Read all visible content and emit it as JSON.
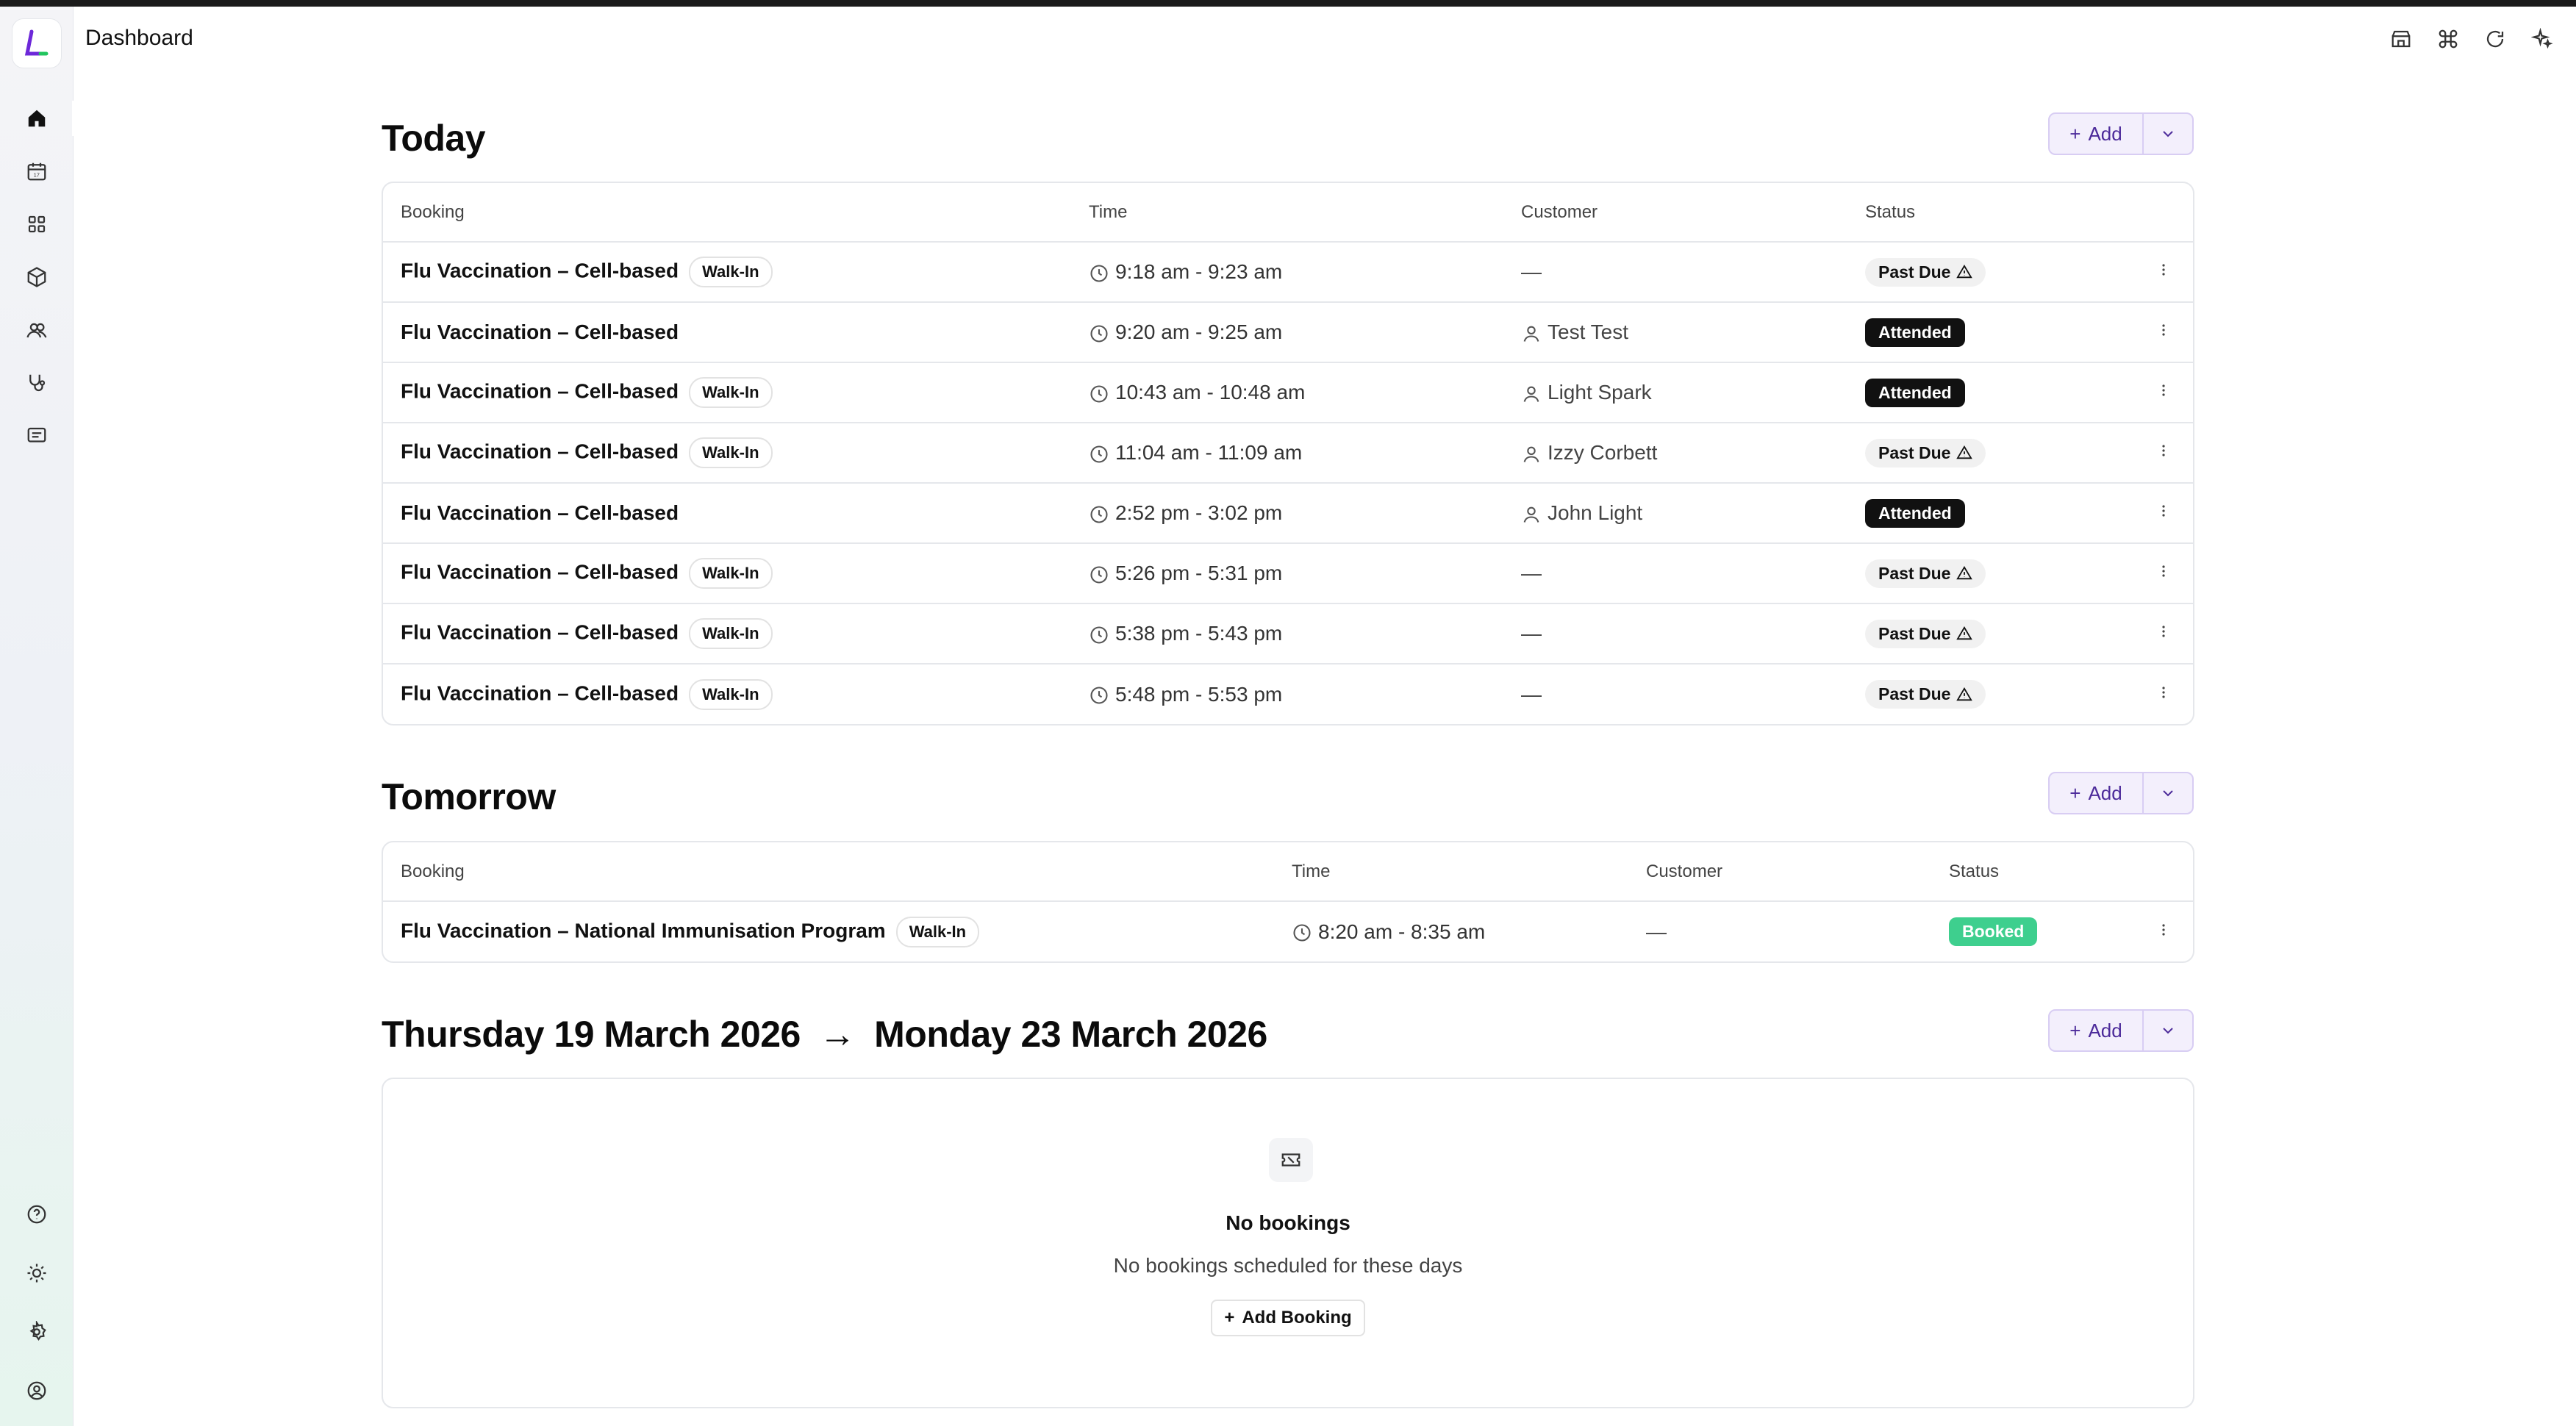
{
  "header": {
    "title": "Dashboard"
  },
  "sidebar": {
    "items": [
      {
        "name": "home-icon"
      },
      {
        "name": "calendar-icon"
      },
      {
        "name": "apps-grid-icon"
      },
      {
        "name": "package-icon"
      },
      {
        "name": "users-icon"
      },
      {
        "name": "stethoscope-icon"
      },
      {
        "name": "message-icon"
      }
    ],
    "bottom": [
      {
        "name": "help-icon"
      },
      {
        "name": "sun-icon"
      },
      {
        "name": "gear-icon"
      },
      {
        "name": "account-icon"
      }
    ]
  },
  "top_icons": [
    "store-icon",
    "command-icon",
    "refresh-icon",
    "sparkle-icon"
  ],
  "buttons": {
    "add": "Add",
    "add_booking": "Add Booking"
  },
  "columns": {
    "booking": "Booking",
    "time": "Time",
    "customer": "Customer",
    "status": "Status"
  },
  "today": {
    "title": "Today",
    "rows": [
      {
        "booking": "Flu Vaccination – Cell-based",
        "tag": "Walk-In",
        "time": "9:18 am - 9:23 am",
        "customer": "—",
        "status": "Past Due"
      },
      {
        "booking": "Flu Vaccination – Cell-based",
        "tag": "",
        "time": "9:20 am - 9:25 am",
        "customer": "Test Test",
        "status": "Attended"
      },
      {
        "booking": "Flu Vaccination – Cell-based",
        "tag": "Walk-In",
        "time": "10:43 am - 10:48 am",
        "customer": "Light Spark",
        "status": "Attended"
      },
      {
        "booking": "Flu Vaccination – Cell-based",
        "tag": "Walk-In",
        "time": "11:04 am - 11:09 am",
        "customer": "Izzy Corbett",
        "status": "Past Due"
      },
      {
        "booking": "Flu Vaccination – Cell-based",
        "tag": "",
        "time": "2:52 pm - 3:02 pm",
        "customer": "John Light",
        "status": "Attended"
      },
      {
        "booking": "Flu Vaccination – Cell-based",
        "tag": "Walk-In",
        "time": "5:26 pm - 5:31 pm",
        "customer": "—",
        "status": "Past Due"
      },
      {
        "booking": "Flu Vaccination – Cell-based",
        "tag": "Walk-In",
        "time": "5:38 pm - 5:43 pm",
        "customer": "—",
        "status": "Past Due"
      },
      {
        "booking": "Flu Vaccination – Cell-based",
        "tag": "Walk-In",
        "time": "5:48 pm - 5:53 pm",
        "customer": "—",
        "status": "Past Due"
      }
    ]
  },
  "tomorrow": {
    "title": "Tomorrow",
    "rows": [
      {
        "booking": "Flu Vaccination – National Immunisation Program",
        "tag": "Walk-In",
        "time": "8:20 am - 8:35 am",
        "customer": "—",
        "status": "Booked"
      }
    ]
  },
  "range": {
    "from": "Thursday 19 March 2026",
    "arrow": "→",
    "to": "Monday 23 March 2026",
    "empty_title": "No bookings",
    "empty_sub": "No bookings scheduled for these days"
  },
  "colors": {
    "accent": "#4c2a9a",
    "booked": "#3ecf8e",
    "attended": "#111111"
  }
}
